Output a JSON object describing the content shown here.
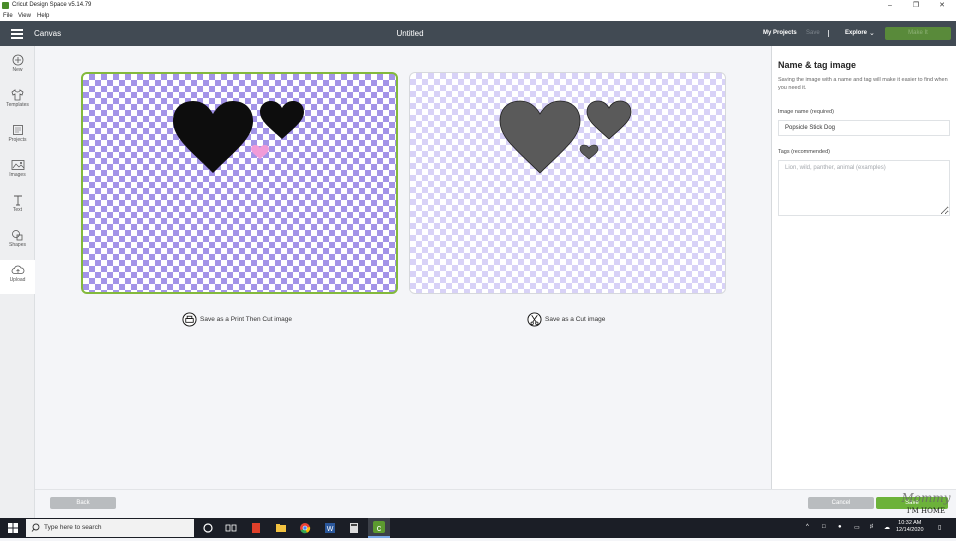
{
  "window": {
    "title": "Cricut Design Space  v5.14.79",
    "controls": [
      "–",
      "❐",
      "✕"
    ]
  },
  "menu": [
    "File",
    "View",
    "Help"
  ],
  "header": {
    "section": "Canvas",
    "doc_title": "Untitled",
    "my_projects": "My Projects",
    "save": "Save",
    "explore": "Explore",
    "make_it": "Make It"
  },
  "sidebar": {
    "items": [
      {
        "label": "New",
        "icon": "plus-icon"
      },
      {
        "label": "Templates",
        "icon": "tshirt-icon"
      },
      {
        "label": "Projects",
        "icon": "projects-icon"
      },
      {
        "label": "Images",
        "icon": "image-icon"
      },
      {
        "label": "Text",
        "icon": "text-icon"
      },
      {
        "label": "Shapes",
        "icon": "shapes-icon"
      },
      {
        "label": "Upload",
        "icon": "upload-icon"
      }
    ]
  },
  "options": {
    "print_then_cut": "Save as a Print Then Cut image",
    "cut": "Save as a Cut image"
  },
  "panel": {
    "title": "Name & tag image",
    "description": "Saving the image with a name and tag will make it easier to find when you need it.",
    "name_label": "Image name (required)",
    "name_value": "Popsicle Stick Dog",
    "tags_label": "Tags (recommended)",
    "tags_placeholder": "Lion, wild, panther, animal (examples)"
  },
  "footer": {
    "back": "Back",
    "cancel": "Cancel",
    "save": "Save"
  },
  "colors": {
    "accent_green": "#6cb23a",
    "header_bg": "#414a53",
    "checker_purple": "#a394e8",
    "heart_print": "#0d0d0d",
    "heart_pink": "#f19bd8",
    "heart_cut": "#5a5a5a"
  },
  "taskbar": {
    "search_placeholder": "Type here to search",
    "time": "10:32 AM",
    "date": "12/14/2020"
  },
  "watermark": {
    "line1": "Mommy",
    "line2": "I'M HOME"
  }
}
